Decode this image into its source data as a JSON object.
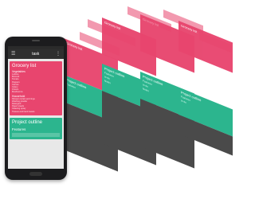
{
  "phone": {
    "appbar": {
      "menu_icon": "hamburger-icon",
      "title": "task",
      "more_icon": "overflow-icon"
    },
    "grocery": {
      "title": "Grocery list",
      "vegetables_label": "Vegetables",
      "vegetables": [
        "Lettuce",
        "Broccoli",
        "Tomato",
        "Peppers",
        "Carrots",
        "Celery",
        "Onions",
        "Mushrooms"
      ],
      "household_label": "Household",
      "household": [
        "Shower curtain and rings",
        "Washing powder",
        "Detergent",
        "Paper towels",
        "Cleaning spray"
      ],
      "more": "Tissues and hand towels"
    },
    "project": {
      "title": "Project outline",
      "features_label": "Features"
    }
  },
  "stacks": [
    {
      "green_title": "Project outline",
      "green_lines": [
        "Features"
      ],
      "pink_title": "Grocery list"
    },
    {
      "green_title": "Project outline",
      "green_lines": [
        "Features",
        "to do",
        "Notes"
      ],
      "pink_title": "Grocery list"
    },
    {
      "green_title": "Project outline",
      "green_lines": [
        "Features",
        "to do",
        "Notes"
      ],
      "pink_title": "Grocery list"
    },
    {
      "green_title": "Project outline",
      "green_lines": [
        "Features",
        "to do"
      ],
      "pink_title": "Grocery list"
    }
  ],
  "colors": {
    "pink": "#e8456e",
    "green": "#2cb58e",
    "slate": "#4a4a4a",
    "phone": "#1c1c1e"
  }
}
